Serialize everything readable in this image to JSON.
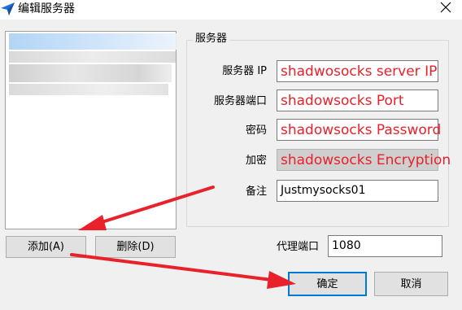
{
  "window": {
    "title": "编辑服务器"
  },
  "server_group": {
    "title": "服务器",
    "fields": [
      {
        "key": "ip",
        "label": "服务器 IP",
        "value": "shadwosocks server IP"
      },
      {
        "key": "port",
        "label": "服务器端口",
        "value": "shadowsocks Port"
      },
      {
        "key": "password",
        "label": "密码",
        "value": "shadowsocks Password"
      },
      {
        "key": "encryption",
        "label": "加密",
        "value": "shadowsocks Encryption"
      },
      {
        "key": "remarks",
        "label": "备注",
        "value": "Justmysocks01"
      }
    ]
  },
  "buttons": {
    "add": "添加(A)",
    "delete": "删除(D)",
    "ok": "确定",
    "cancel": "取消"
  },
  "proxy_port": {
    "label": "代理端口",
    "value": "1080"
  },
  "colors": {
    "annotation_red": "#e8212a",
    "focus_border": "#0078d7",
    "app_icon_blue": "#1e6fd9"
  },
  "icons": {
    "app": "paper-plane-icon",
    "close": "close-icon"
  }
}
